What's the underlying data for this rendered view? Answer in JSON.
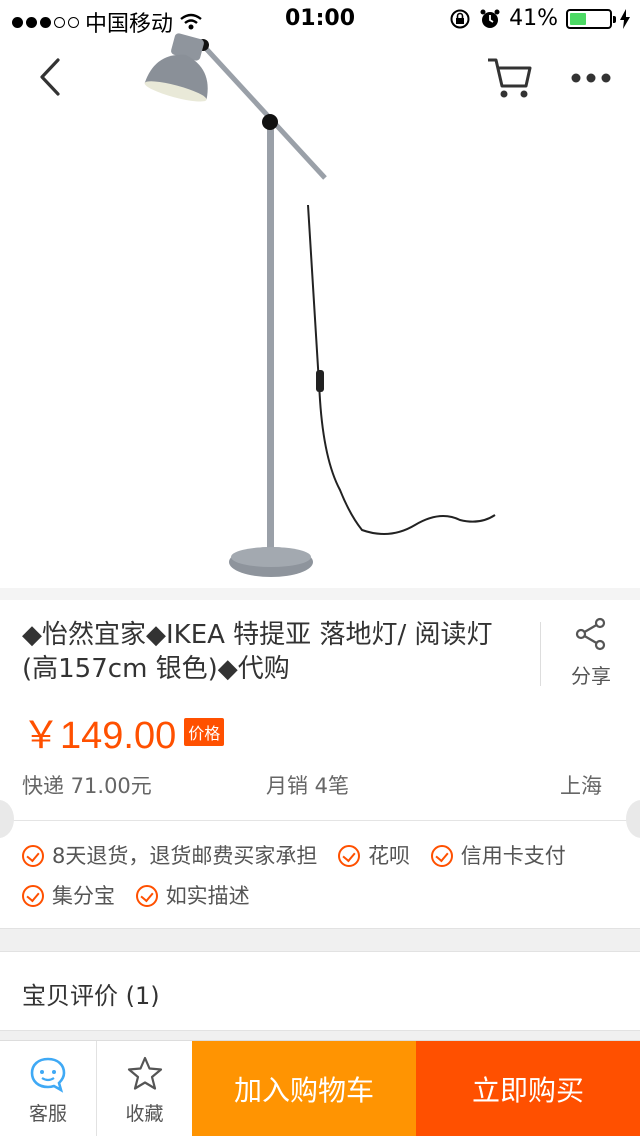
{
  "status_bar": {
    "carrier": "中国移动",
    "time": "01:00",
    "battery": "41%",
    "battery_level": 0.41
  },
  "nav": {
    "back_icon": "chevron-left-icon",
    "cart_icon": "shopping-cart-icon",
    "more_icon": "more-horizontal-icon"
  },
  "product": {
    "title": "◆怡然宜家◆IKEA 特提亚 落地灯/ 阅读灯(高157cm 银色)◆代购",
    "share_label": "分享",
    "price": "￥149.00",
    "price_tag": "价格",
    "shipping": "快递 71.00元",
    "monthly_sales": "月销 4笔",
    "location": "上海"
  },
  "services": [
    {
      "label": "8天退货，退货邮费买家承担"
    },
    {
      "label": "花呗"
    },
    {
      "label": "信用卡支付"
    },
    {
      "label": "集分宝"
    },
    {
      "label": "如实描述"
    }
  ],
  "reviews": {
    "label": "宝贝评价 (1)"
  },
  "bottom_bar": {
    "service_label": "客服",
    "favorite_label": "收藏",
    "add_to_cart_label": "加入购物车",
    "buy_now_label": "立即购买"
  },
  "colors": {
    "accent": "#ff5000",
    "cart_button": "#ff9402",
    "service_icon": "#3fa9f5"
  }
}
